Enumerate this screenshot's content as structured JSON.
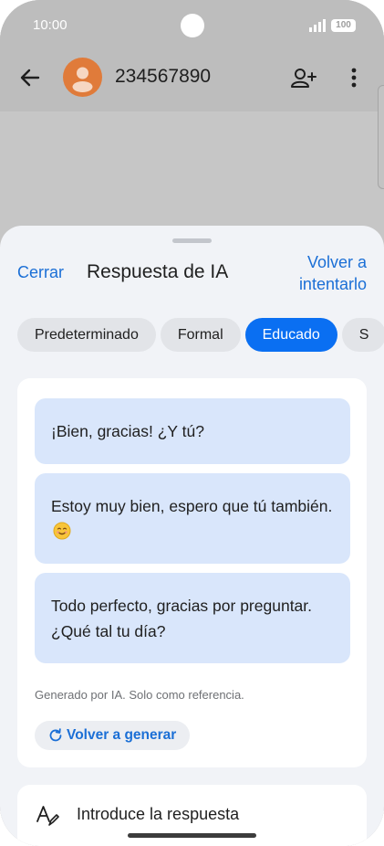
{
  "status_bar": {
    "time": "10:00",
    "battery": "100"
  },
  "contact": {
    "name": "234567890"
  },
  "sheet": {
    "close_label": "Cerrar",
    "title": "Respuesta de IA",
    "retry_label": "Volver a intentarlo",
    "tones": [
      {
        "label": "Predeterminado",
        "selected": false
      },
      {
        "label": "Formal",
        "selected": false
      },
      {
        "label": "Educado",
        "selected": true
      },
      {
        "label": "S",
        "selected": false
      }
    ],
    "suggestions": [
      {
        "text": "¡Bien, gracias! ¿Y tú?"
      },
      {
        "text": "Estoy muy bien, espero que tú también.",
        "emoji": "smiling-face-icon"
      },
      {
        "text": "Todo perfecto, gracias por preguntar. ¿Qué tal tu día?"
      }
    ],
    "disclaimer": "Generado por IA. Solo como referencia.",
    "regenerate_label": "Volver a generar",
    "input_placeholder": "Introduce la respuesta"
  },
  "colors": {
    "accent": "#0a6ff2",
    "link": "#1b6fd6",
    "suggestion_bg": "#d9e6fb",
    "avatar": "#e07b3a",
    "sheet_bg": "#f1f3f7"
  }
}
